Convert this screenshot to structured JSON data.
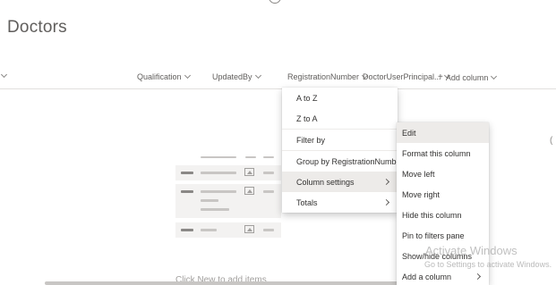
{
  "page": {
    "title": "Doctors"
  },
  "columns": [
    {
      "label": "Qualification"
    },
    {
      "label": "UpdatedBy"
    },
    {
      "label": "RegistrationNumber"
    },
    {
      "label": "DoctorUserPrincipal..."
    }
  ],
  "add_column": {
    "label": "Add column"
  },
  "sort_menu": {
    "items": [
      "A to Z",
      "Z to A",
      "Filter by",
      "Group by RegistrationNumber",
      "Column settings",
      "Totals"
    ]
  },
  "settings_menu": {
    "items": [
      "Edit",
      "Format this column",
      "Move left",
      "Move right",
      "Hide this column",
      "Pin to filters pane",
      "Show/hide columns",
      "Add a column"
    ]
  },
  "bottom_hint": "Click New to add items",
  "watermark": {
    "title": "Activate Windows",
    "subtitle": "Go to Settings to activate Windows."
  },
  "colors": {
    "menu_hover": "#edebe9",
    "text": "#323130",
    "muted": "#605e5c"
  }
}
